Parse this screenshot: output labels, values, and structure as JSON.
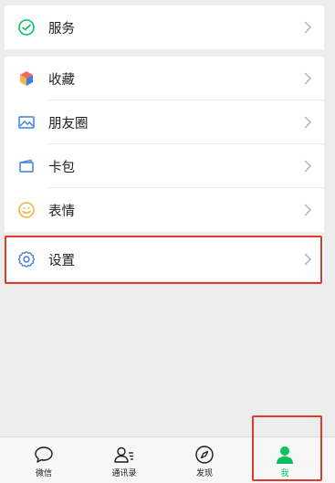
{
  "menu": {
    "services": {
      "label": "服务",
      "icon": "services-icon"
    },
    "favorites": {
      "label": "收藏",
      "icon": "favorites-cube-icon"
    },
    "moments": {
      "label": "朋友圈",
      "icon": "moments-photo-icon"
    },
    "cards": {
      "label": "卡包",
      "icon": "card-wallet-icon"
    },
    "stickers": {
      "label": "表情",
      "icon": "smiley-icon"
    },
    "settings": {
      "label": "设置",
      "icon": "gear-icon"
    }
  },
  "tabbar": {
    "chats": {
      "label": "微信",
      "icon": "chat-bubble-icon"
    },
    "contacts": {
      "label": "通讯录",
      "icon": "contacts-icon"
    },
    "discover": {
      "label": "发现",
      "icon": "compass-icon"
    },
    "me": {
      "label": "我",
      "icon": "person-icon",
      "active": true
    }
  },
  "colors": {
    "accent_green": "#07c160",
    "highlight_red": "#e03a2f",
    "background": "#ededed"
  }
}
